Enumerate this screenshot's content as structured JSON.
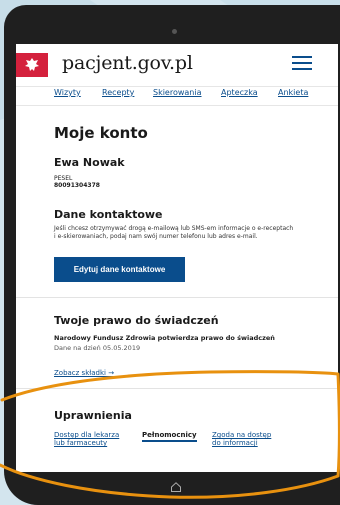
{
  "site": {
    "brand": "pacjent.gov.pl"
  },
  "nav": {
    "items": [
      "Wizyty",
      "Recepty",
      "Skierowania",
      "Apteczka",
      "Ankieta"
    ]
  },
  "account": {
    "title": "Moje konto",
    "user_name": "Ewa Nowak",
    "pesel_label": "PESEL",
    "pesel_value": "80091304378"
  },
  "contact": {
    "title": "Dane kontaktowe",
    "description_line1": "Jeśli chcesz otrzymywać drogą e-mailową lub SMS-em informacje o e-receptach",
    "description_line2": "i e-skierowaniach, podaj nam swój numer telefonu lub adres e-mail.",
    "edit_button": "Edytuj dane kontaktowe"
  },
  "benefits": {
    "title": "Twoje prawo do świadczeń",
    "status": "Narodowy Fundusz Zdrowia potwierdza prawo do świadczeń",
    "date": "Dane na dzień 05.05.2019",
    "link": "Zobacz składki →"
  },
  "permissions": {
    "title": "Uprawnienia",
    "link1_line1": "Dostęp dla lekarza",
    "link1_line2": "lub farmaceuty",
    "active": "Pełnomocnicy",
    "link3_line1": "Zgoda na dostęp",
    "link3_line2": "do informacji"
  },
  "colors": {
    "primary": "#0a4d8c",
    "brand_red": "#d4213d",
    "annotation": "#e8910f"
  }
}
